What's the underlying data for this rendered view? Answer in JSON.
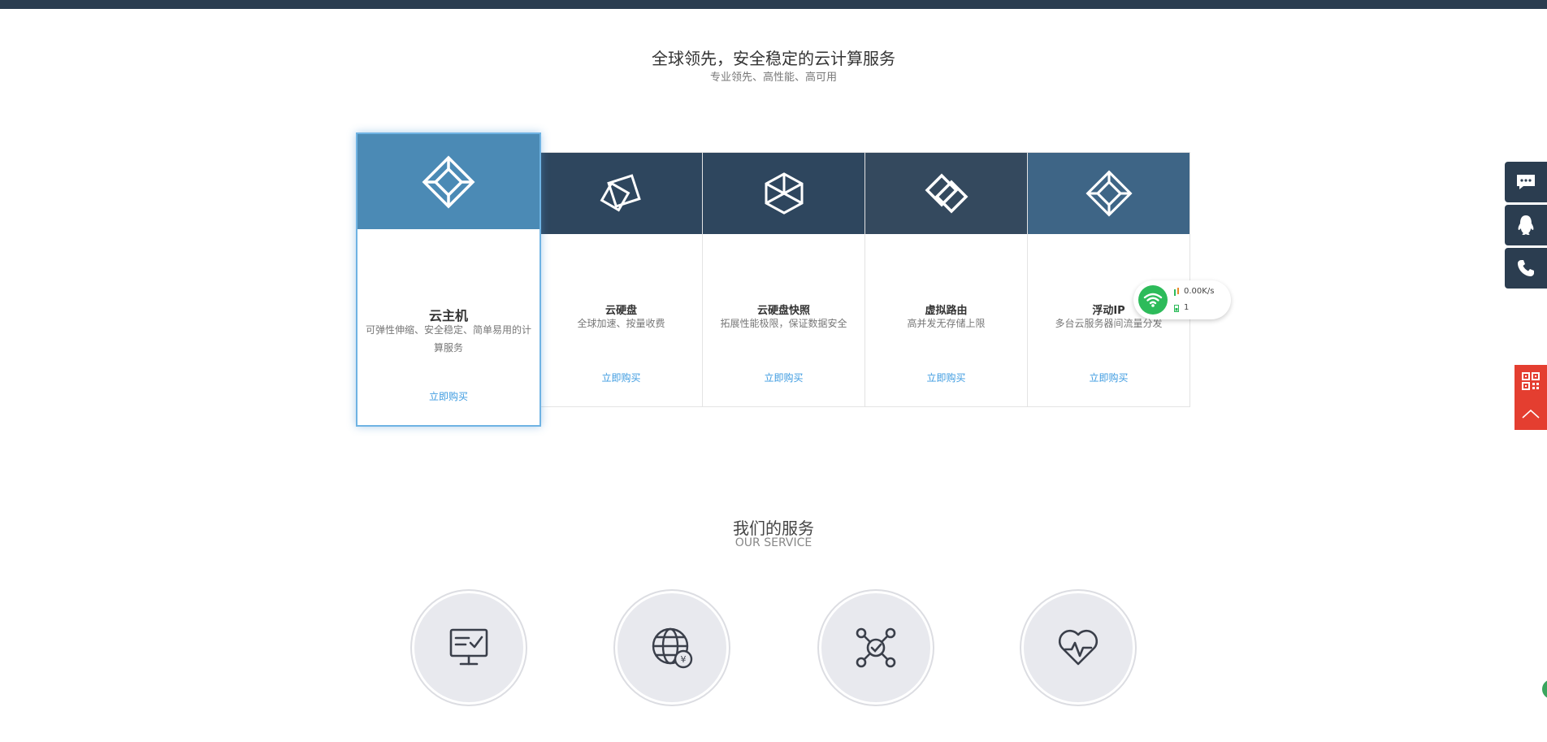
{
  "hero": {
    "title": "全球领先，安全稳定的云计算服务",
    "subtitle": "专业领先、高性能、高可用"
  },
  "products": [
    {
      "name": "云主机",
      "desc": "可弹性伸缩、安全稳定、简单易用的计算服务",
      "buy": "立即购买"
    },
    {
      "name": "云硬盘",
      "desc": "全球加速、按量收费",
      "buy": "立即购买"
    },
    {
      "name": "云硬盘快照",
      "desc": "拓展性能极限，保证数据安全",
      "buy": "立即购买"
    },
    {
      "name": "虚拟路由",
      "desc": "高并发无存储上限",
      "buy": "立即购买"
    },
    {
      "name": "浮动IP",
      "desc": "多台云服务器间流量分发",
      "buy": "立即购买"
    }
  ],
  "network_widget": {
    "speed": "0.00K/s",
    "count": "1"
  },
  "services": {
    "title": "我们的服务",
    "subtitle": "OUR SERVICE",
    "icons": [
      "monitor-check-icon",
      "globe-yen-icon",
      "network-check-icon",
      "heart-pulse-icon"
    ]
  },
  "colors": {
    "topbar": "#2b3d50",
    "active_head": "#4b8ab5",
    "dark_head": "#2e465e",
    "link": "#3d9be0",
    "sidebar": "#2b3d50",
    "sidebar_red": "#e43e30",
    "wifi_green": "#2dbb5a"
  }
}
